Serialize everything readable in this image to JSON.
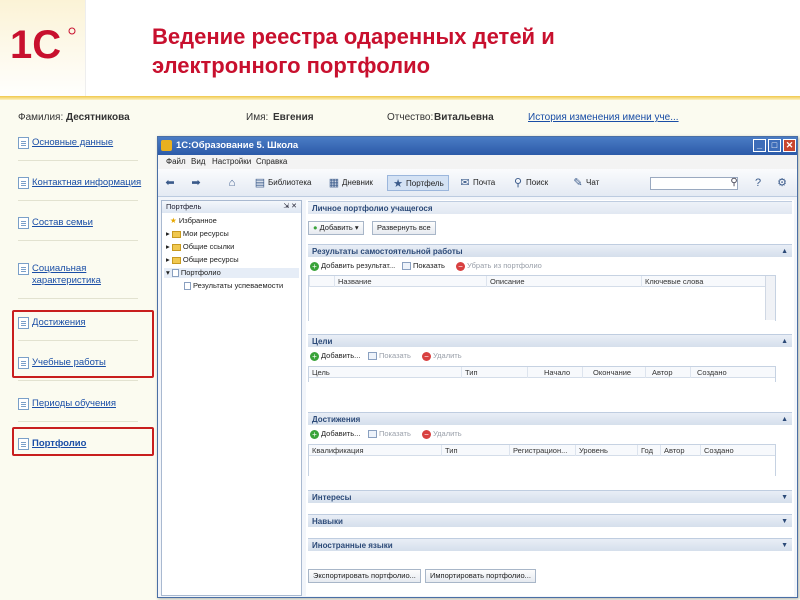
{
  "slide": {
    "title": "Ведение реестра одаренных детей и\nэлектронного портфолио",
    "logo_text": "1С",
    "colors": {
      "title": "#c8102e",
      "logo": "#c8102e",
      "accent": "#2c5aa8"
    }
  },
  "person": {
    "surname_label": "Фамилия:",
    "surname": "Десятникова",
    "name_label": "Имя:",
    "name": "Евгения",
    "patronymic_label": "Отчество:",
    "patronymic": "Витальевна",
    "history_link": "История изменения имени уче..."
  },
  "left_nav": {
    "items": [
      {
        "label": "Основные данные"
      },
      {
        "label": "Контактная информация"
      },
      {
        "label": "Состав семьи"
      },
      {
        "label": "Социальная характеристика"
      },
      {
        "label": "Достижения"
      },
      {
        "label": "Учебные работы"
      },
      {
        "label": "Периоды обучения"
      },
      {
        "label": "Портфолио"
      }
    ]
  },
  "window": {
    "title": "1С:Образование 5. Школа",
    "menu": [
      "Файл",
      "Вид",
      "Настройки",
      "Справка"
    ],
    "toolbar": [
      {
        "label": "Библиотека",
        "icon": "book-icon"
      },
      {
        "label": "Дневник",
        "icon": "diary-icon"
      },
      {
        "label": "Портфель",
        "icon": "star-icon",
        "active": true
      },
      {
        "label": "Почта",
        "icon": "mail-icon"
      },
      {
        "label": "Поиск",
        "icon": "search-icon"
      },
      {
        "label": "Чат",
        "icon": "chat-icon"
      }
    ],
    "search_placeholder": ""
  },
  "tree": {
    "header": "Портфель",
    "items": [
      {
        "label": "Избранное"
      },
      {
        "label": "Мои ресурсы"
      },
      {
        "label": "Общие ссылки"
      },
      {
        "label": "Общие ресурсы"
      },
      {
        "label": "Портфолио"
      },
      {
        "label": "Результаты успеваемости"
      }
    ]
  },
  "portfolio": {
    "header": "Личное портфолио учащегося",
    "add_button": "Добавить",
    "expand_button": "Развернуть все",
    "sections": {
      "self_work": {
        "title": "Результаты самостоятельной работы",
        "cmd_add": "Добавить результат...",
        "cmd_show": "Показать",
        "cmd_remove": "Убрать из портфолио",
        "columns": [
          "Название",
          "Описание",
          "Ключевые слова"
        ]
      },
      "goals": {
        "title": "Цели",
        "cmd_add": "Добавить...",
        "cmd_show": "Показать",
        "cmd_remove": "Удалить",
        "columns": [
          "Цель",
          "Тип",
          "Начало",
          "Окончание",
          "Автор",
          "Создано"
        ]
      },
      "achievements": {
        "title": "Достижения",
        "cmd_add": "Добавить...",
        "cmd_show": "Показать",
        "cmd_remove": "Удалить",
        "columns": [
          "Квалификация",
          "Тип",
          "Регистрацион...",
          "Уровень",
          "Год",
          "Автор",
          "Создано"
        ]
      },
      "interests": {
        "title": "Интересы"
      },
      "skills": {
        "title": "Навыки"
      },
      "languages": {
        "title": "Иностранные языки"
      }
    },
    "export_button": "Экспортировать портфолио...",
    "import_button": "Импортировать портфолио..."
  }
}
